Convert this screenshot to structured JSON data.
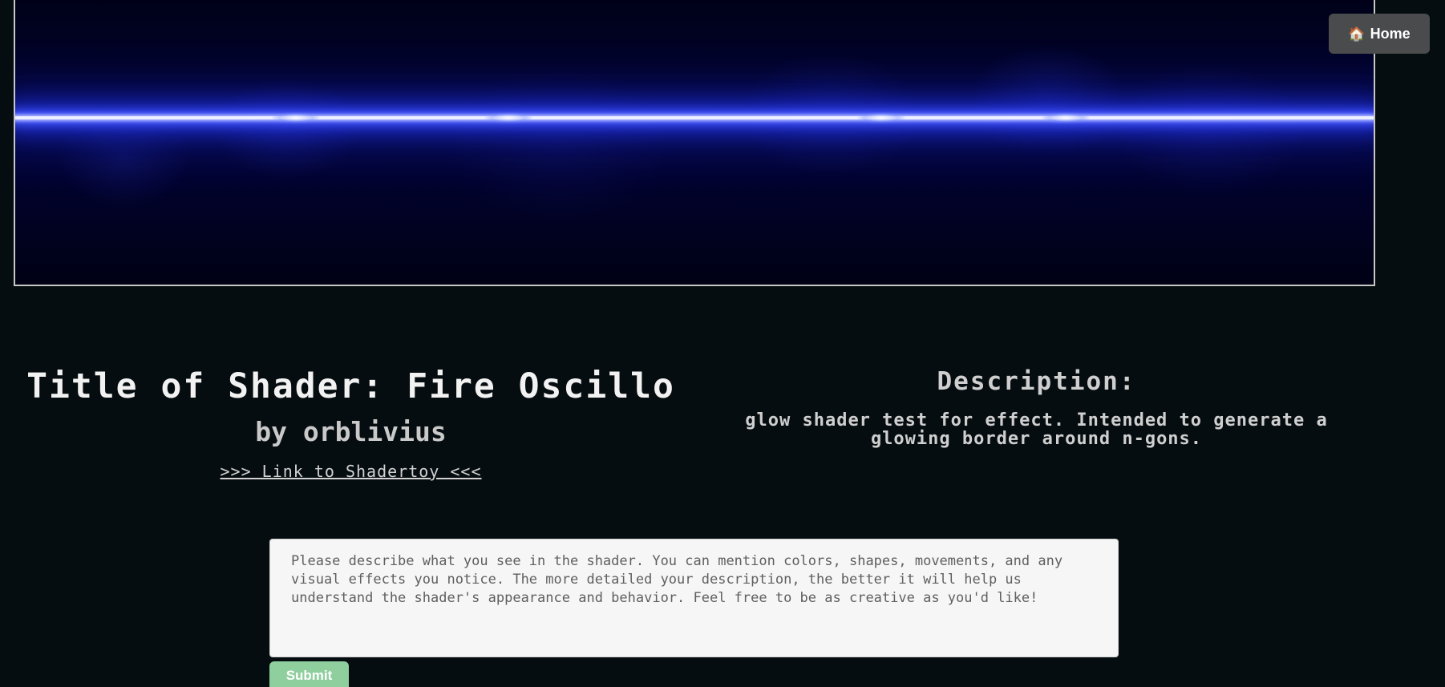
{
  "nav": {
    "home_label": "Home",
    "home_icon": "🏠"
  },
  "shader": {
    "title": "Title of Shader: Fire Oscillo",
    "author": "by orblivius",
    "link_text": ">>> Link to Shadertoy <<<"
  },
  "description": {
    "heading": "Description:",
    "text": "glow shader test for effect. Intended to generate a glowing border around n-gons."
  },
  "form": {
    "placeholder": "Please describe what you see in the shader. You can mention colors, shapes, movements, and any visual effects you notice. The more detailed your description, the better it will help us understand the shader's appearance and behavior. Feel free to be as creative as you'd like!",
    "submit_label": "Submit"
  },
  "colors": {
    "background": "#060d10",
    "home_button": "#4a4b4c",
    "submit_button": "#8fcf9e",
    "glow": "#4a5cff"
  }
}
